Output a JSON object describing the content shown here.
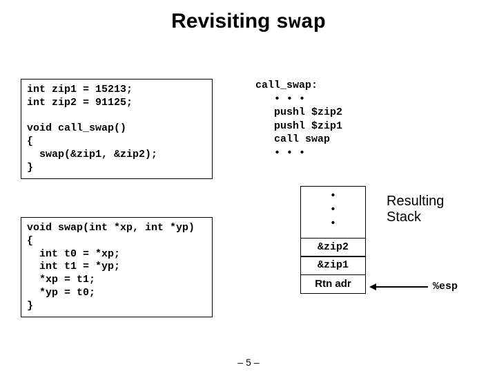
{
  "title": {
    "plain": "Revisiting ",
    "mono": "swap"
  },
  "code_top": "int zip1 = 15213;\nint zip2 = 91125;\n\nvoid call_swap()\n{\n  swap(&zip1, &zip2);\n}",
  "code_bottom": "void swap(int *xp, int *yp)\n{\n  int t0 = *xp;\n  int t1 = *yp;\n  *xp = t1;\n  *yp = t0;\n}",
  "asm": "call_swap:\n   • • •\n   pushl $zip2\n   pushl $zip1\n   call swap\n   • • •",
  "stack": {
    "dots": "•\n•\n•",
    "cell1": "&zip2",
    "cell2": "&zip1",
    "cell3": "Rtn adr"
  },
  "labels": {
    "result": "Resulting\nStack",
    "esp": "%esp"
  },
  "footer": "– 5 –"
}
